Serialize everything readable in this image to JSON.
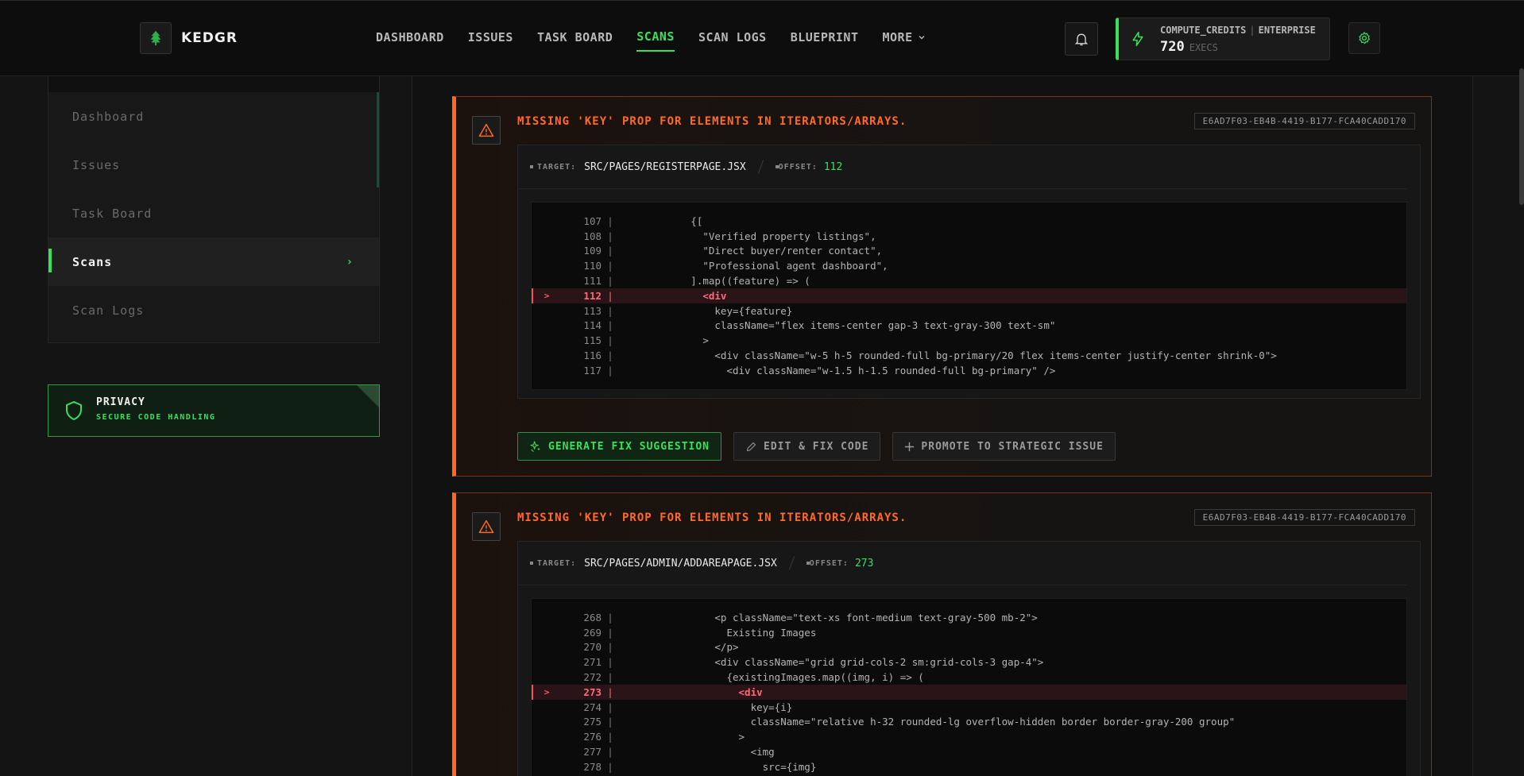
{
  "app": {
    "name": "KEDGR"
  },
  "nav": {
    "items": [
      "DASHBOARD",
      "ISSUES",
      "TASK BOARD",
      "SCANS",
      "SCAN LOGS",
      "BLUEPRINT",
      "MORE"
    ],
    "active": "SCANS"
  },
  "credits": {
    "label": "COMPUTE_CREDITS",
    "plan": "ENTERPRISE",
    "value": "720",
    "unit": "EXECS"
  },
  "sidebar": {
    "items": [
      {
        "label": "Dashboard"
      },
      {
        "label": "Issues"
      },
      {
        "label": "Task Board"
      },
      {
        "label": "Scans",
        "active": true
      },
      {
        "label": "Scan Logs"
      }
    ],
    "privacy": {
      "title": "PRIVACY",
      "subtitle": "SECURE CODE HANDLING"
    }
  },
  "issues": [
    {
      "title": "MISSING 'KEY' PROP FOR ELEMENTS IN ITERATORS/ARRAYS.",
      "id": "E6AD7F03-EB4B-4419-B177-FCA40CADD170",
      "target_label": "TARGET:",
      "target": "SRC/PAGES/REGISTERPAGE.JSX",
      "offset_label": "OFFSET:",
      "offset": "112",
      "code": [
        {
          "n": "107",
          "t": "            {["
        },
        {
          "n": "108",
          "t": "              \"Verified property listings\","
        },
        {
          "n": "109",
          "t": "              \"Direct buyer/renter contact\","
        },
        {
          "n": "110",
          "t": "              \"Professional agent dashboard\","
        },
        {
          "n": "111",
          "t": "            ].map((feature) => ("
        },
        {
          "n": "112",
          "t": "              <div",
          "hl": true,
          "marker": ">"
        },
        {
          "n": "113",
          "t": "                key={feature}"
        },
        {
          "n": "114",
          "t": "                className=\"flex items-center gap-3 text-gray-300 text-sm\""
        },
        {
          "n": "115",
          "t": "              >"
        },
        {
          "n": "116",
          "t": "                <div className=\"w-5 h-5 rounded-full bg-primary/20 flex items-center justify-center shrink-0\">"
        },
        {
          "n": "117",
          "t": "                  <div className=\"w-1.5 h-1.5 rounded-full bg-primary\" />"
        }
      ],
      "actions": [
        "GENERATE FIX SUGGESTION",
        "EDIT & FIX CODE",
        "PROMOTE TO STRATEGIC ISSUE"
      ]
    },
    {
      "title": "MISSING 'KEY' PROP FOR ELEMENTS IN ITERATORS/ARRAYS.",
      "id": "E6AD7F03-EB4B-4419-B177-FCA40CADD170",
      "target_label": "TARGET:",
      "target": "SRC/PAGES/ADMIN/ADDAREAPAGE.JSX",
      "offset_label": "OFFSET:",
      "offset": "273",
      "code": [
        {
          "n": "268",
          "t": "                <p className=\"text-xs font-medium text-gray-500 mb-2\">"
        },
        {
          "n": "269",
          "t": "                  Existing Images"
        },
        {
          "n": "270",
          "t": "                </p>"
        },
        {
          "n": "271",
          "t": "                <div className=\"grid grid-cols-2 sm:grid-cols-3 gap-4\">"
        },
        {
          "n": "272",
          "t": "                  {existingImages.map((img, i) => ("
        },
        {
          "n": "273",
          "t": "                    <div",
          "hl": true,
          "marker": ">"
        },
        {
          "n": "274",
          "t": "                      key={i}"
        },
        {
          "n": "275",
          "t": "                      className=\"relative h-32 rounded-lg overflow-hidden border border-gray-200 group\""
        },
        {
          "n": "276",
          "t": "                    >"
        },
        {
          "n": "277",
          "t": "                      <img"
        },
        {
          "n": "278",
          "t": "                        src={img}"
        }
      ]
    }
  ],
  "colors": {
    "accent": "#39e05c",
    "warning": "#ff6a1a",
    "error": "#ff4a5a"
  }
}
